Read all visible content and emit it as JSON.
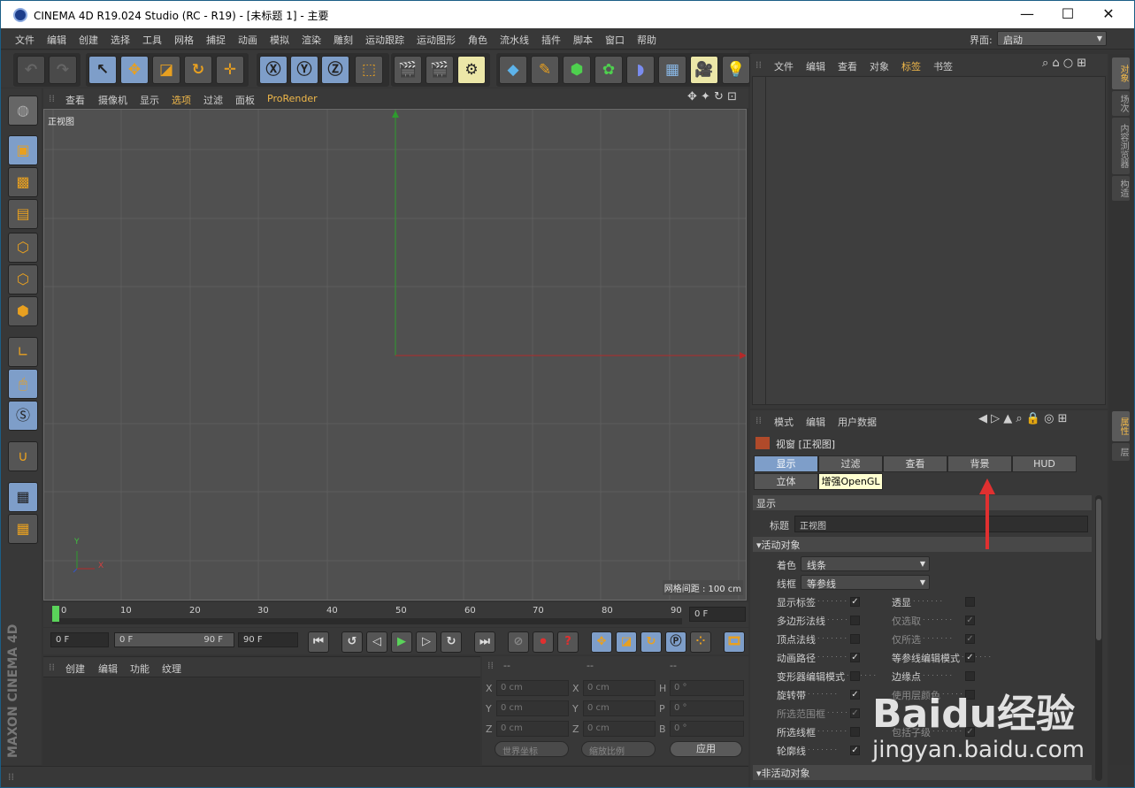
{
  "title_bar": {
    "title": "CINEMA 4D R19.024 Studio (RC - R19) - [未标题 1] - 主要",
    "minimize": "—",
    "maximize": "☐",
    "close": "✕"
  },
  "menu": {
    "items": [
      "文件",
      "编辑",
      "创建",
      "选择",
      "工具",
      "网格",
      "捕捉",
      "动画",
      "模拟",
      "渲染",
      "雕刻",
      "运动跟踪",
      "运动图形",
      "角色",
      "流水线",
      "插件",
      "脚本",
      "窗口",
      "帮助"
    ],
    "layout_label": "界面:",
    "layout_value": "启动"
  },
  "viewport": {
    "menu": [
      "查看",
      "摄像机",
      "显示",
      "选项",
      "过滤",
      "面板",
      "ProRender"
    ],
    "label": "正视图",
    "grid_info": "网格间距 : 100 cm",
    "axis_y": "Y",
    "axis_x": "X"
  },
  "timeline": {
    "ticks": [
      "0",
      "10",
      "20",
      "30",
      "40",
      "50",
      "60",
      "70",
      "80",
      "90"
    ],
    "end_field": "0 F"
  },
  "playback": {
    "start": "0 F",
    "range_start": "0 F",
    "range_end": "90 F",
    "end": "90 F"
  },
  "material_panel": {
    "menu": [
      "创建",
      "编辑",
      "功能",
      "纹理"
    ]
  },
  "coordinates": {
    "headers": [
      "--",
      "--",
      "--"
    ],
    "rows": [
      {
        "a": "X",
        "av": "0 cm",
        "b": "X",
        "bv": "0 cm",
        "c": "H",
        "cv": "0 °"
      },
      {
        "a": "Y",
        "av": "0 cm",
        "b": "Y",
        "bv": "0 cm",
        "c": "P",
        "cv": "0 °"
      },
      {
        "a": "Z",
        "av": "0 cm",
        "b": "Z",
        "bv": "0 cm",
        "c": "B",
        "cv": "0 °"
      }
    ],
    "world": "世界坐标",
    "scale": "缩放比例",
    "apply": "应用"
  },
  "object_panel": {
    "menu": [
      "文件",
      "编辑",
      "查看",
      "对象",
      "标签",
      "书签"
    ]
  },
  "right_tabs": [
    "对象",
    "场次",
    "内容浏览器",
    "构造",
    "属性",
    "层"
  ],
  "attributes": {
    "menu": [
      "模式",
      "编辑",
      "用户数据"
    ],
    "title": "视窗 [正视图]",
    "tabs": [
      "显示",
      "过滤",
      "查看",
      "背景",
      "HUD"
    ],
    "tabs2": [
      "立体",
      "增强OpenGL"
    ],
    "section_display": "显示",
    "title_label": "标题",
    "title_value": "正视图",
    "section_active": "▾活动对象",
    "shading_label": "着色",
    "shading_value": "线条",
    "wire_label": "线框",
    "wire_value": "等参线",
    "left_props": [
      {
        "label": "显示标签",
        "checked": true,
        "dim": false
      },
      {
        "label": "多边形法线",
        "checked": false,
        "dim": false
      },
      {
        "label": "顶点法线",
        "checked": false,
        "dim": false
      },
      {
        "label": "动画路径",
        "checked": true,
        "dim": false
      },
      {
        "label": "变形器编辑模式",
        "checked": false,
        "dim": false
      },
      {
        "label": "旋转带",
        "checked": true,
        "dim": false
      },
      {
        "label": "所选范围框",
        "checked": true,
        "dim": true
      },
      {
        "label": "所选线框",
        "checked": false,
        "dim": false
      },
      {
        "label": "轮廓线",
        "checked": true,
        "dim": false
      }
    ],
    "right_props": [
      {
        "label": "透显",
        "checked": false,
        "dim": false
      },
      {
        "label": "仅选取",
        "checked": true,
        "dim": true
      },
      {
        "label": "仅所选",
        "checked": true,
        "dim": true
      },
      {
        "label": "等参线编辑模式",
        "checked": true,
        "dim": false
      },
      {
        "label": "边缘点",
        "checked": false,
        "dim": false
      },
      {
        "label": "使用层颜色",
        "checked": false,
        "dim": true
      },
      {
        "label": "",
        "checked": false,
        "dim": false
      },
      {
        "label": "包括子级",
        "checked": true,
        "dim": true
      }
    ],
    "section_inactive": "▾非活动对象"
  },
  "watermark": {
    "brand": "Baidu经验",
    "url": "jingyan.baidu.com"
  },
  "branding": "MAXON CINEMA 4D"
}
